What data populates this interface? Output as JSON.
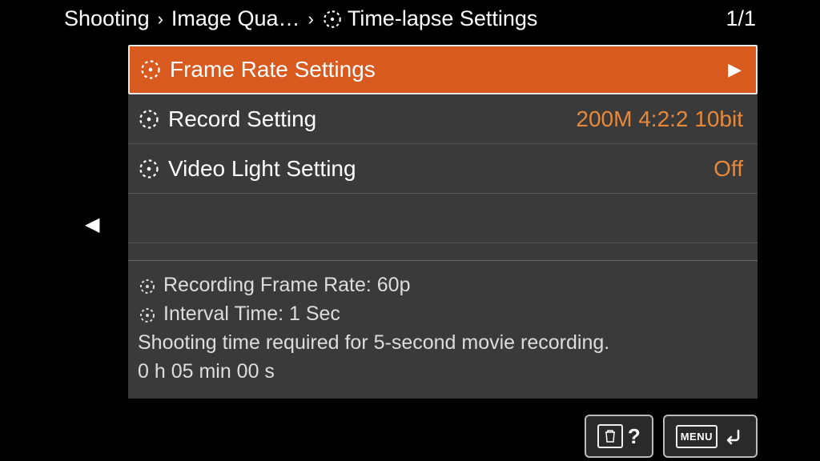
{
  "breadcrumb": {
    "level1": "Shooting",
    "level2": "Image Qua…",
    "level3": "Time-lapse Settings"
  },
  "page_indicator": "1/1",
  "menu": {
    "items": [
      {
        "label": "Frame Rate Settings",
        "value": "",
        "has_arrow": true,
        "selected": true
      },
      {
        "label": "Record Setting",
        "value": "200M 4:2:2 10bit",
        "has_arrow": false,
        "selected": false
      },
      {
        "label": "Video Light Setting",
        "value": "Off",
        "has_arrow": false,
        "selected": false
      }
    ]
  },
  "info": {
    "line1": "Recording Frame Rate: 60p",
    "line2": "Interval Time: 1 Sec",
    "line3": "Shooting time required for 5-second movie recording.",
    "line4": "0 h 05 min 00 s"
  },
  "buttons": {
    "help": "?",
    "menu": "MENU"
  }
}
